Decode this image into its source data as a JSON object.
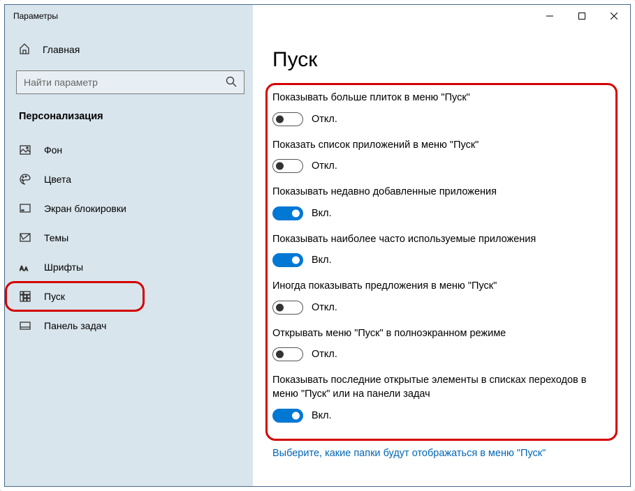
{
  "window": {
    "title": "Параметры"
  },
  "sidebar": {
    "home": "Главная",
    "search_placeholder": "Найти параметр",
    "section": "Персонализация",
    "items": [
      {
        "label": "Фон"
      },
      {
        "label": "Цвета"
      },
      {
        "label": "Экран блокировки"
      },
      {
        "label": "Темы"
      },
      {
        "label": "Шрифты"
      },
      {
        "label": "Пуск"
      },
      {
        "label": "Панель задач"
      }
    ]
  },
  "content": {
    "title": "Пуск",
    "settings": [
      {
        "label": "Показывать больше плиток в меню \"Пуск\"",
        "on": false
      },
      {
        "label": "Показать список приложений в меню \"Пуск\"",
        "on": false
      },
      {
        "label": "Показывать недавно добавленные приложения",
        "on": true
      },
      {
        "label": "Показывать наиболее часто используемые приложения",
        "on": true
      },
      {
        "label": "Иногда показывать предложения в меню \"Пуск\"",
        "on": false
      },
      {
        "label": "Открывать меню \"Пуск\" в полноэкранном режиме",
        "on": false
      },
      {
        "label": "Показывать последние открытые элементы в списках переходов в меню \"Пуск\" или на панели задач",
        "on": true
      }
    ],
    "state_on": "Вкл.",
    "state_off": "Откл.",
    "link": "Выберите, какие папки будут отображаться в меню \"Пуск\""
  }
}
